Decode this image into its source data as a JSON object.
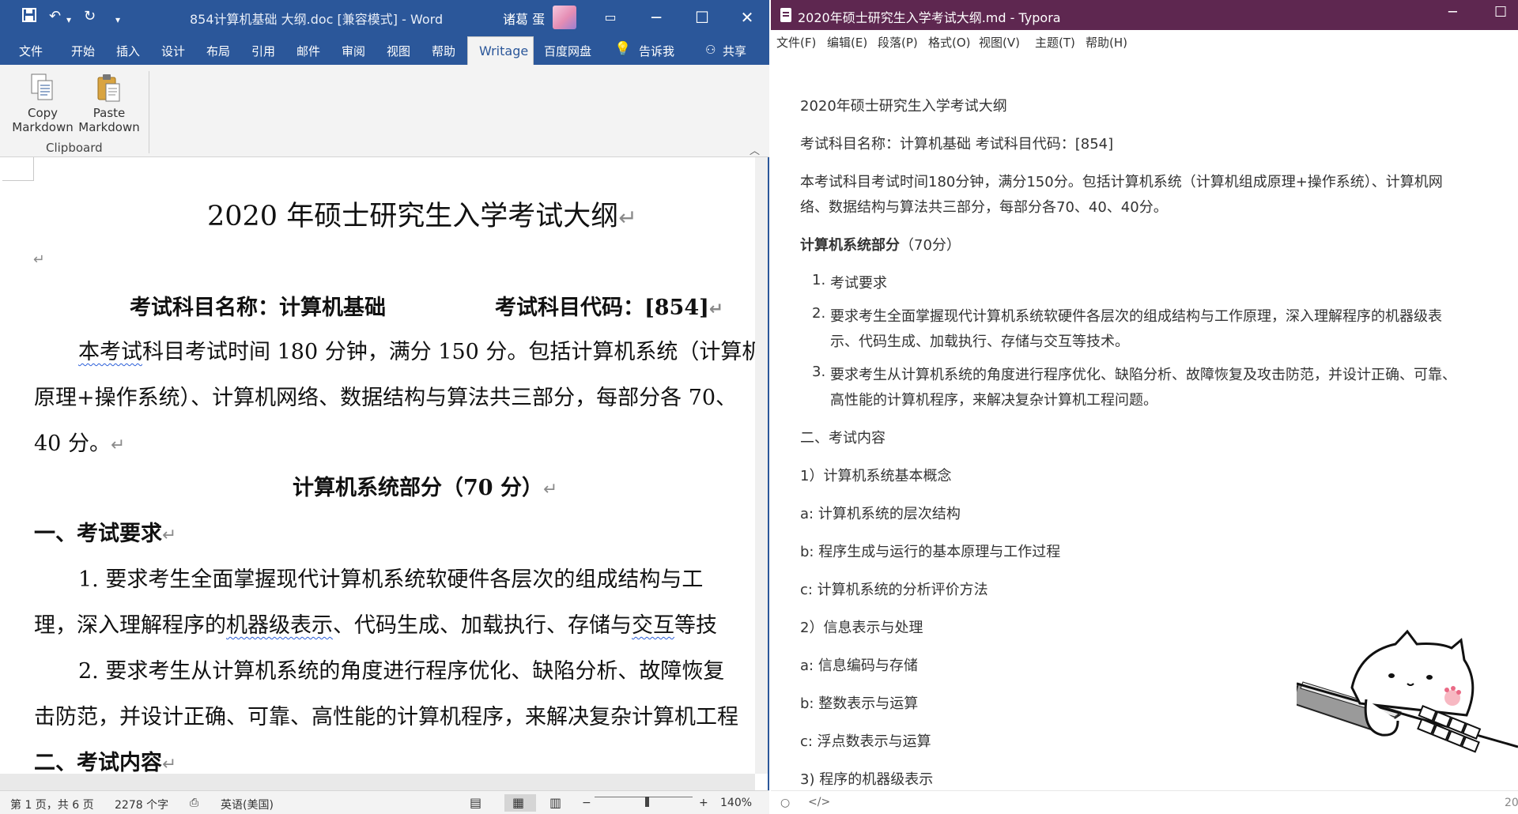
{
  "word": {
    "title": "854计算机基础 大纲.doc [兼容模式]  -  Word",
    "user": "诸葛 蛋",
    "tabs": [
      "文件",
      "开始",
      "插入",
      "设计",
      "布局",
      "引用",
      "邮件",
      "审阅",
      "视图",
      "帮助",
      "Writage",
      "百度网盘"
    ],
    "tell_me": "告诉我",
    "share": "共享",
    "ribbon": {
      "copy_line1": "Copy",
      "copy_line2": "Markdown",
      "paste_line1": "Paste",
      "paste_line2": "Markdown",
      "group": "Clipboard"
    },
    "doc": {
      "title": "2020 年硕士研究生入学考试大纲",
      "subject_name": "考试科目名称：计算机基础",
      "subject_code": "考试科目代码：[854]",
      "para1_line1_a": "本考试",
      "para1_line1_b": "科目考试时间 180 分钟，满分 150 分。包括计算机系统（计算机",
      "para1_line2": "原理+操作系统）、计算机网络、数据结构与算法共三部分，每部分各  70、",
      "para1_line3": "40 分。",
      "section_heading": "计算机系统部分（70 分）",
      "h1": "一、考试要求",
      "item1_line1": "1.  要求考生全面掌握现代计算机系统软硬件各层次的组成结构与工",
      "item1_line2_a": "理，深入理解程序的",
      "item1_line2_b": "机器级表示",
      "item1_line2_c": "、代码生成、加载执行、存储与",
      "item1_line2_d": "交互",
      "item1_line2_e": "等技",
      "item2_line1": "2.  要求考生从计算机系统的角度进行程序优化、缺陷分析、故障恢复",
      "item2_line2": "击防范，并设计正确、可靠、高性能的计算机程序，来解决复杂计算机工程",
      "h2": "二、考试内容"
    },
    "status": {
      "page": "第 1 页，共 6 页",
      "words": "2278 个字",
      "language": "英语(美国)",
      "zoom": "140%",
      "zoom_fraction": 0.53
    }
  },
  "typora": {
    "title": "2020年硕士研究生入学考试大纲.md - Typora",
    "menu": [
      "文件(F)",
      "编辑(E)",
      "段落(P)",
      "格式(O)",
      "视图(V)",
      "主题(T)",
      "帮助(H)"
    ],
    "content": {
      "title": "2020年硕士研究生入学考试大纲",
      "subject": "考试科目名称：计算机基础     考试科目代码：[854]",
      "para1_line1": "本考试科目考试时间180分钟，满分150分。包括计算机系统（计算机组成原理+操作系统）、计算机网",
      "para1_line2": "络、数据结构与算法共三部分，每部分各70、40、40分。",
      "section_bold": "计算机系统部分",
      "section_rest": "（70分）",
      "list": [
        {
          "num": "1.",
          "lines": [
            "考试要求"
          ]
        },
        {
          "num": "2.",
          "lines": [
            "要求考生全面掌握现代计算机系统软硬件各层次的组成结构与工作原理，深入理解程序的机器级表",
            "示、代码生成、加载执行、存储与交互等技术。"
          ]
        },
        {
          "num": "3.",
          "lines": [
            "要求考生从计算机系统的角度进行程序优化、缺陷分析、故障恢复及攻击防范，并设计正确、可靠、",
            "高性能的计算机程序，来解决复杂计算机工程问题。"
          ]
        }
      ],
      "h2": "二、考试内容",
      "p1": "1）计算机系统基本概念",
      "a1": "a: 计算机系统的层次结构",
      "b1": "b: 程序生成与运行的基本原理与工作过程",
      "c1": "c: 计算机系统的分析评价方法",
      "p2": "2）信息表示与处理",
      "a2": "a: 信息编码与存储",
      "b2": "b: 整数表示与运算",
      "c2": "c: 浮点数表示与运算",
      "p3": "3) 程序的机器级表示"
    },
    "status": {
      "count": "20"
    }
  },
  "colors": {
    "word_blue": "#2b579a",
    "typora_purple": "#5e2750"
  }
}
